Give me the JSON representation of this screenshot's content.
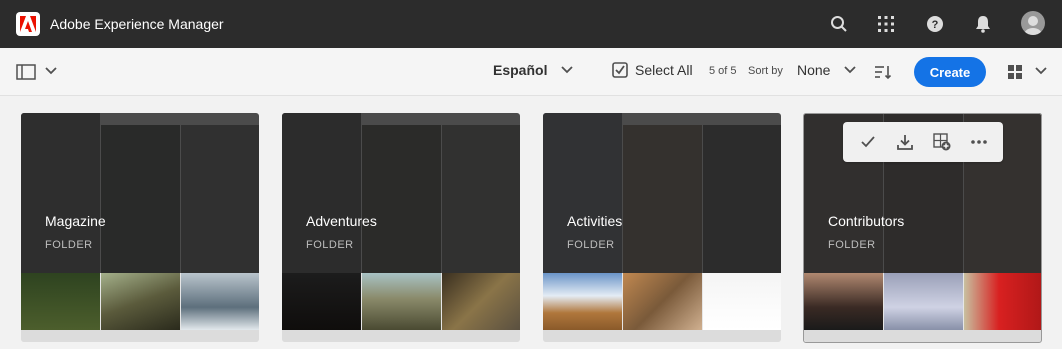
{
  "app": {
    "title": "Adobe Experience Manager"
  },
  "appbar_icons": [
    "search-icon",
    "apps-icon",
    "help-icon",
    "notifications-icon",
    "avatar"
  ],
  "toolbar": {
    "language": "Español",
    "select_all": "Select All",
    "count": "5 of 5",
    "sort_by_label": "Sort by",
    "sort_value": "None",
    "create_label": "Create"
  },
  "cards": [
    {
      "title": "Magazine",
      "subtitle": "FOLDER"
    },
    {
      "title": "Adventures",
      "subtitle": "FOLDER"
    },
    {
      "title": "Activities",
      "subtitle": "FOLDER"
    },
    {
      "title": "Contributors",
      "subtitle": "FOLDER"
    }
  ],
  "quick_actions": [
    "select-check-icon",
    "download-icon",
    "add-to-collection-icon",
    "more-icon"
  ],
  "colors": {
    "appbar": "#2c2c2c",
    "accent": "#1473e6"
  }
}
